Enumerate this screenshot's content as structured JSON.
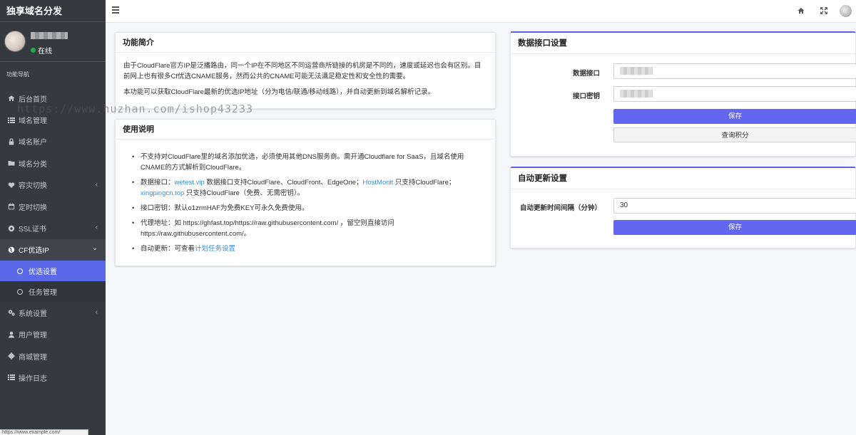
{
  "brand": "独享域名分发",
  "user": {
    "status": "在线"
  },
  "nav": {
    "header": "功能导航",
    "items": [
      {
        "label": "后台首页",
        "icon": "home-icon"
      },
      {
        "label": "域名管理",
        "icon": "list-icon"
      },
      {
        "label": "域名账户",
        "icon": "lock-icon"
      },
      {
        "label": "域名分类",
        "icon": "folder-icon"
      },
      {
        "label": "容灾切换",
        "icon": "heart-icon",
        "arrow": "‹"
      },
      {
        "label": "定时切换",
        "icon": "calendar-icon"
      },
      {
        "label": "SSL证书",
        "icon": "settings-icon",
        "arrow": "‹"
      },
      {
        "label": "CF优选IP",
        "icon": "globe-icon",
        "arrow": "⌄"
      }
    ],
    "sub_items": [
      {
        "label": "优选设置"
      },
      {
        "label": "任务管理"
      }
    ],
    "items_after": [
      {
        "label": "系统设置",
        "icon": "cogs-icon",
        "arrow": "‹"
      },
      {
        "label": "用户管理",
        "icon": "user-icon"
      },
      {
        "label": "商城管理",
        "icon": "gear-icon"
      },
      {
        "label": "操作日志",
        "icon": "list-icon"
      }
    ]
  },
  "status_url": "https://www.example.com/",
  "watermark": "https://www.huzhan.com/ishop43233",
  "intro_card": {
    "title": "功能简介",
    "p1": "由于CloudFlare官方IP是泛播路由，同一个IP在不同地区不同运营商所链接的机房是不同的，速度或延迟也会有区别。目前网上也有很多Cf优选CNAME服务，然而公共的CNAME可能无法满足稳定性和安全性的需要。",
    "p2": "本功能可以获取CloudFlare最新的优选IP地址（分为电信/联通/移动线路），并自动更新到域名解析记录。"
  },
  "usage_card": {
    "title": "使用说明",
    "li1": "不支持对CloudFlare里的域名添加优选，必须使用其他DNS服务商。需开通Cloudflare for SaaS，且域名使用CNAME的方式解析到CloudFlare。",
    "li2_prefix": "数据接口：",
    "li2_link1": "wetest.vip",
    "li2_mid1": " 数据接口支持CloudFlare、CloudFront、EdgeOne；",
    "li2_link2": "HostMonit",
    "li2_mid2": " 只支持CloudFlare；",
    "li2_link3": "xingpingcn.top",
    "li2_suffix": " 只支持CloudFlare（免费、无需密钥）。",
    "li3": "接口密钥：默认o1zrmHAF为免费KEY可永久免费使用。",
    "li4": "代理地址：如 https://ghfast.top/https://raw.githubusercontent.com/ ，留空则直接访问https://raw.githubusercontent.com/。",
    "li5_prefix": "自动更新：可查看",
    "li5_link": "计划任务设置"
  },
  "api_card": {
    "title": "数据接口设置",
    "label_api": "数据接口",
    "label_key": "接口密钥",
    "save": "保存",
    "query": "查询积分"
  },
  "auto_card": {
    "title": "自动更新设置",
    "label_interval": "自动更新时间间隔（分钟）",
    "interval_value": "30",
    "save": "保存"
  }
}
